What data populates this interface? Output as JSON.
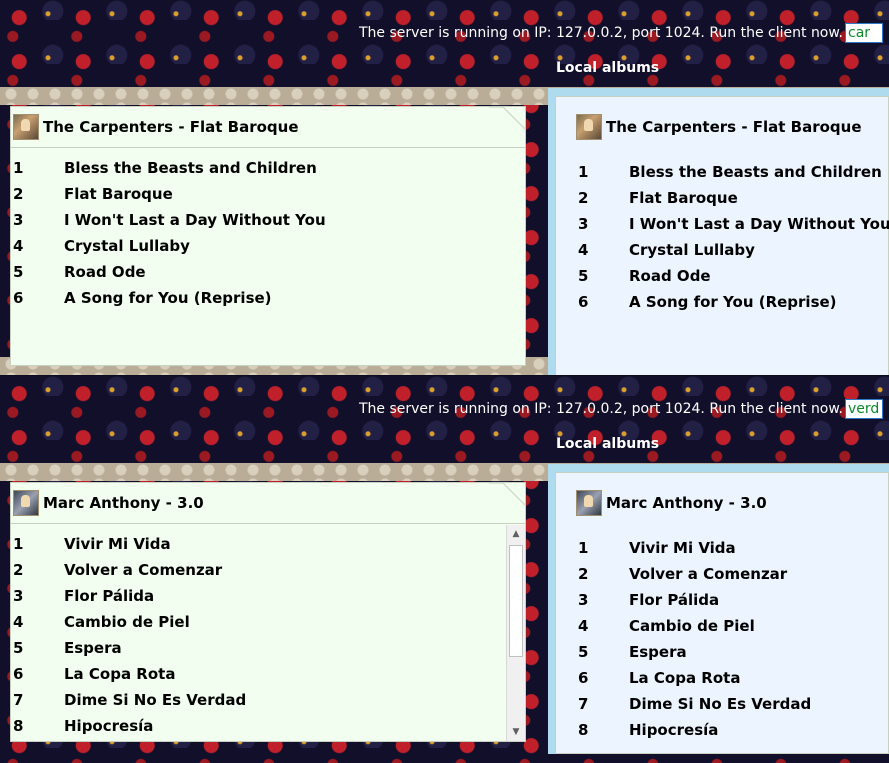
{
  "panels": [
    {
      "status_text": "The server is running on IP: 127.0.0.2, port 1024. Run the client now.",
      "filter_value": "car",
      "local_albums_label": "Local albums",
      "left_album": {
        "title": "The Carpenters - Flat Baroque",
        "tracks": [
          {
            "num": "1",
            "name": "Bless the Beasts and Children"
          },
          {
            "num": "2",
            "name": "Flat Baroque"
          },
          {
            "num": "3",
            "name": "I Won't Last a Day Without You"
          },
          {
            "num": "4",
            "name": "Crystal Lullaby"
          },
          {
            "num": "5",
            "name": "Road Ode"
          },
          {
            "num": "6",
            "name": "A Song for You (Reprise)"
          }
        ]
      },
      "right_album": {
        "title": "The Carpenters - Flat Baroque",
        "tracks": [
          {
            "num": "1",
            "name": "Bless the Beasts and Children"
          },
          {
            "num": "2",
            "name": "Flat Baroque"
          },
          {
            "num": "3",
            "name": "I Won't Last a Day Without You"
          },
          {
            "num": "4",
            "name": "Crystal Lullaby"
          },
          {
            "num": "5",
            "name": "Road Ode"
          },
          {
            "num": "6",
            "name": "A Song for You (Reprise)"
          }
        ]
      }
    },
    {
      "status_text": "The server is running on IP: 127.0.0.2, port 1024. Run the client now.",
      "filter_value": "verd",
      "local_albums_label": "Local albums",
      "left_album": {
        "title": "Marc Anthony - 3.0",
        "tracks": [
          {
            "num": "1",
            "name": "Vivir Mi Vida"
          },
          {
            "num": "2",
            "name": "Volver a Comenzar"
          },
          {
            "num": "3",
            "name": "Flor Pálida"
          },
          {
            "num": "4",
            "name": "Cambio de Piel"
          },
          {
            "num": "5",
            "name": "Espera"
          },
          {
            "num": "6",
            "name": "La Copa Rota"
          },
          {
            "num": "7",
            "name": "Dime Si No Es Verdad"
          },
          {
            "num": "8",
            "name": "Hipocresía"
          }
        ]
      },
      "right_album": {
        "title": "Marc Anthony - 3.0",
        "tracks": [
          {
            "num": "1",
            "name": "Vivir Mi Vida"
          },
          {
            "num": "2",
            "name": "Volver a Comenzar"
          },
          {
            "num": "3",
            "name": "Flor Pálida"
          },
          {
            "num": "4",
            "name": "Cambio de Piel"
          },
          {
            "num": "5",
            "name": "Espera"
          },
          {
            "num": "6",
            "name": "La Copa Rota"
          },
          {
            "num": "7",
            "name": "Dime Si No Es Verdad"
          },
          {
            "num": "8",
            "name": "Hipocresía"
          }
        ]
      }
    }
  ],
  "icons": {
    "album_cover": "album-cover-icon",
    "scroll_up": "scroll-up-arrow-icon",
    "scroll_down": "scroll-down-arrow-icon"
  },
  "colors": {
    "filter_text": "#0a8a2a",
    "left_card_bg": "#f2fff0",
    "right_card_bg": "#ecf5ff"
  }
}
